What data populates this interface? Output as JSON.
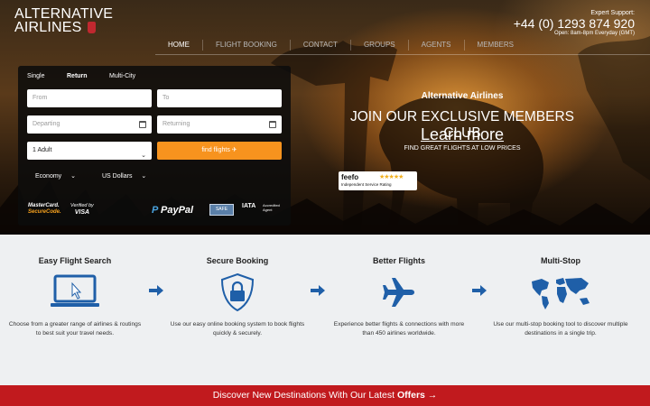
{
  "header": {
    "logo_line1": "ALTERNATIVE",
    "logo_line2": "AIRLINES",
    "support_label": "Expert Support:",
    "phone": "+44 (0) 1293 874 920",
    "hours": "Open: 8am-8pm Everyday (GMT)"
  },
  "nav": [
    "HOME",
    "FLIGHT BOOKING",
    "CONTACT",
    "GROUPS",
    "AGENTS",
    "MEMBERS"
  ],
  "search": {
    "trip_types": [
      "Single",
      "Return",
      "Multi-City"
    ],
    "active_trip": "Return",
    "from_placeholder": "From",
    "to_placeholder": "To",
    "departing_placeholder": "Departing",
    "returning_placeholder": "Returning",
    "passengers": "1 Adult",
    "find_button": "find flights",
    "cabin": "Economy",
    "currency": "US Dollars"
  },
  "payments": {
    "mastercard_line1": "MasterCard.",
    "mastercard_line2": "SecureCode.",
    "visa_line1": "Verified by",
    "visa_line2": "VISA",
    "paypal": "PayPal",
    "safe_badge": "SAFE",
    "iata": "IATA",
    "iata_sub": "Accredited Agent"
  },
  "promo": {
    "brand": "Alternative Airlines",
    "headline": "JOIN OUR EXCLUSIVE MEMBERS CLUB",
    "cta": "Learn more",
    "sub": "FIND GREAT FLIGHTS AT LOW PRICES",
    "feefo_logo": "feefo",
    "feefo_caption": "Independent Service Rating"
  },
  "features": [
    {
      "title": "Easy Flight Search",
      "icon": "laptop-icon",
      "desc": "Choose from a greater range of airlines & routings to best suit your travel needs."
    },
    {
      "title": "Secure Booking",
      "icon": "shield-lock-icon",
      "desc": "Use our easy online booking system to book flights quickly & securely."
    },
    {
      "title": "Better Flights",
      "icon": "airplane-icon",
      "desc": "Experience better flights & connections with more than 450 airlines worldwide."
    },
    {
      "title": "Multi-Stop",
      "icon": "world-map-icon",
      "desc": "Use our multi-stop booking tool to discover multiple destinations in a single trip."
    }
  ],
  "banner": {
    "text_start": "Discover New Destinations With Our Latest ",
    "text_bold": "Offers",
    "arrow": "→"
  },
  "colors": {
    "accent_orange": "#f7931e",
    "banner_red": "#c11a1e",
    "icon_blue": "#1f5fa8"
  }
}
